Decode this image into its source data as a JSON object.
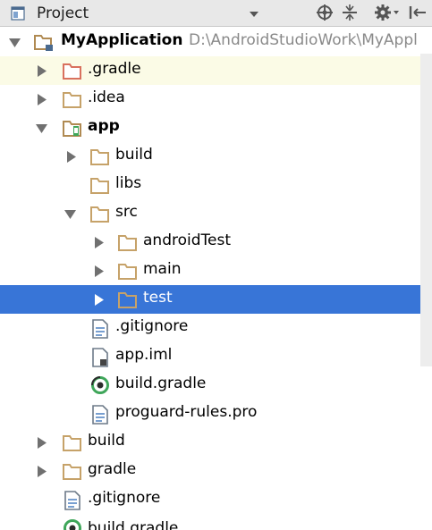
{
  "toolbar": {
    "view_label": "Project",
    "view_icon": "project-view-icon",
    "buttons": [
      "locate-target-icon",
      "collapse-all-icon",
      "settings-gear-icon",
      "hide-panel-icon"
    ]
  },
  "tree": [
    {
      "label": "MyApplication",
      "path": "D:\\AndroidStudioWork\\MyAppl",
      "icon": "module-folder-icon",
      "expanded": true
    },
    {
      "label": ".gradle",
      "icon": "excluded-folder-icon",
      "expanded": false
    },
    {
      "label": ".idea",
      "icon": "folder-icon",
      "expanded": false
    },
    {
      "label": "app",
      "icon": "android-module-icon",
      "expanded": true
    },
    {
      "label": "build",
      "icon": "folder-icon",
      "expanded": false
    },
    {
      "label": "libs",
      "icon": "folder-icon"
    },
    {
      "label": "src",
      "icon": "folder-icon",
      "expanded": true
    },
    {
      "label": "androidTest",
      "icon": "folder-icon",
      "expanded": false
    },
    {
      "label": "main",
      "icon": "folder-icon",
      "expanded": false
    },
    {
      "label": "test",
      "icon": "folder-icon",
      "expanded": false,
      "selected": true
    },
    {
      "label": ".gitignore",
      "icon": "text-file-icon"
    },
    {
      "label": "app.iml",
      "icon": "iml-file-icon"
    },
    {
      "label": "build.gradle",
      "icon": "gradle-file-icon"
    },
    {
      "label": "proguard-rules.pro",
      "icon": "text-file-icon"
    },
    {
      "label": "build",
      "icon": "folder-icon",
      "expanded": false
    },
    {
      "label": "gradle",
      "icon": "folder-icon",
      "expanded": false
    },
    {
      "label": ".gitignore",
      "icon": "text-file-icon"
    },
    {
      "label": "build.gradle",
      "icon": "gradle-file-icon"
    }
  ],
  "colors": {
    "selection": "#3875d7",
    "folder": "#c6a269",
    "excluded_folder": "#d9715e",
    "gradle_green": "#3fa65a"
  }
}
